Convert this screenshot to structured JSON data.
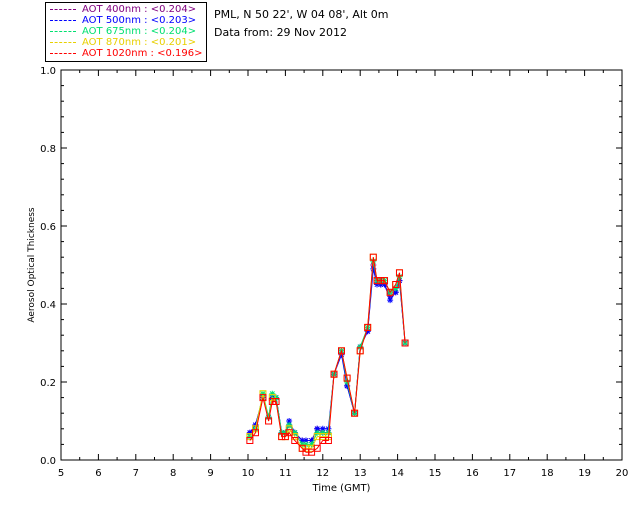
{
  "chart_data": {
    "type": "line",
    "title": "",
    "site_line": "PML, N 50 22', W 04 08', Alt 0m",
    "date_line": "Data from: 29 Nov 2012",
    "xlabel": "Time (GMT)",
    "ylabel": "Aerosol Optical Thickness",
    "xlim": [
      5,
      20
    ],
    "ylim": [
      0.0,
      1.0
    ],
    "xticks": [
      "5",
      "6",
      "7",
      "8",
      "9",
      "10",
      "11",
      "12",
      "13",
      "14",
      "15",
      "16",
      "17",
      "18",
      "19",
      "20"
    ],
    "yticks": [
      "0.0",
      "0.2",
      "0.4",
      "0.6",
      "0.8",
      "1.0"
    ],
    "legend_placement": "top-left",
    "series": [
      {
        "name": "AOT  400nm : <0.204>",
        "color": "#800080",
        "marker": "star",
        "x": [
          10.05,
          10.2,
          10.4,
          10.55,
          10.65,
          10.75,
          10.9,
          11.0,
          11.1,
          11.25,
          11.45,
          11.55,
          11.7,
          11.85,
          12.0,
          12.15,
          12.3,
          12.5,
          12.65,
          12.85,
          13.0,
          13.2,
          13.35,
          13.45,
          13.55,
          13.65,
          13.8,
          13.95,
          14.05,
          14.2
        ],
        "y": [
          0.07,
          0.09,
          0.16,
          0.11,
          0.16,
          0.16,
          0.07,
          0.07,
          0.09,
          0.07,
          0.05,
          0.05,
          0.05,
          0.08,
          0.07,
          0.07,
          0.22,
          0.28,
          0.19,
          0.12,
          0.29,
          0.33,
          0.5,
          0.46,
          0.45,
          0.45,
          0.42,
          0.43,
          0.46,
          0.3
        ]
      },
      {
        "name": "AOT  500nm : <0.203>",
        "color": "#0000ff",
        "marker": "star",
        "x": [
          10.05,
          10.2,
          10.4,
          10.55,
          10.65,
          10.75,
          10.9,
          11.0,
          11.1,
          11.25,
          11.45,
          11.55,
          11.7,
          11.85,
          12.0,
          12.15,
          12.3,
          12.5,
          12.65,
          12.85,
          13.0,
          13.2,
          13.35,
          13.45,
          13.55,
          13.65,
          13.8,
          13.95,
          14.05,
          14.2
        ],
        "y": [
          0.07,
          0.09,
          0.16,
          0.11,
          0.16,
          0.16,
          0.07,
          0.07,
          0.1,
          0.07,
          0.05,
          0.05,
          0.05,
          0.08,
          0.08,
          0.08,
          0.22,
          0.27,
          0.19,
          0.12,
          0.29,
          0.33,
          0.49,
          0.45,
          0.45,
          0.45,
          0.41,
          0.43,
          0.46,
          0.3
        ]
      },
      {
        "name": "AOT  675nm : <0.204>",
        "color": "#00e070",
        "marker": "star",
        "x": [
          10.05,
          10.2,
          10.4,
          10.55,
          10.65,
          10.75,
          10.9,
          11.0,
          11.1,
          11.25,
          11.45,
          11.55,
          11.7,
          11.85,
          12.0,
          12.15,
          12.3,
          12.5,
          12.65,
          12.85,
          13.0,
          13.2,
          13.35,
          13.45,
          13.55,
          13.65,
          13.8,
          13.95,
          14.05,
          14.2
        ],
        "y": [
          0.06,
          0.08,
          0.17,
          0.11,
          0.17,
          0.16,
          0.07,
          0.07,
          0.09,
          0.07,
          0.04,
          0.04,
          0.04,
          0.07,
          0.07,
          0.07,
          0.22,
          0.28,
          0.2,
          0.12,
          0.29,
          0.34,
          0.51,
          0.46,
          0.46,
          0.46,
          0.43,
          0.44,
          0.47,
          0.3
        ]
      },
      {
        "name": "AOT  870nm : <0.201>",
        "color": "#e8d000",
        "marker": "square",
        "x": [
          10.05,
          10.2,
          10.4,
          10.55,
          10.65,
          10.75,
          10.9,
          11.0,
          11.1,
          11.25,
          11.45,
          11.55,
          11.7,
          11.85,
          12.0,
          12.15,
          12.3,
          12.5,
          12.65,
          12.85,
          13.0,
          13.2,
          13.35,
          13.45,
          13.55,
          13.65,
          13.8,
          13.95,
          14.05,
          14.2
        ],
        "y": [
          0.06,
          0.08,
          0.17,
          0.1,
          0.16,
          0.15,
          0.06,
          0.06,
          0.08,
          0.06,
          0.03,
          0.03,
          0.03,
          0.06,
          0.06,
          0.06,
          0.22,
          0.28,
          0.21,
          0.12,
          0.28,
          0.34,
          0.52,
          0.46,
          0.46,
          0.46,
          0.43,
          0.45,
          0.48,
          0.3
        ]
      },
      {
        "name": "AOT 1020nm : <0.196>",
        "color": "#ff0000",
        "marker": "square",
        "x": [
          10.05,
          10.2,
          10.4,
          10.55,
          10.65,
          10.75,
          10.9,
          11.0,
          11.1,
          11.25,
          11.45,
          11.55,
          11.7,
          11.85,
          12.0,
          12.15,
          12.3,
          12.5,
          12.65,
          12.85,
          13.0,
          13.2,
          13.35,
          13.45,
          13.55,
          13.65,
          13.8,
          13.95,
          14.05,
          14.2
        ],
        "y": [
          0.05,
          0.07,
          0.16,
          0.1,
          0.15,
          0.15,
          0.06,
          0.06,
          0.07,
          0.05,
          0.03,
          0.02,
          0.02,
          0.03,
          0.05,
          0.05,
          0.22,
          0.28,
          0.21,
          0.12,
          0.28,
          0.34,
          0.52,
          0.46,
          0.46,
          0.46,
          0.43,
          0.45,
          0.48,
          0.3
        ]
      }
    ]
  }
}
